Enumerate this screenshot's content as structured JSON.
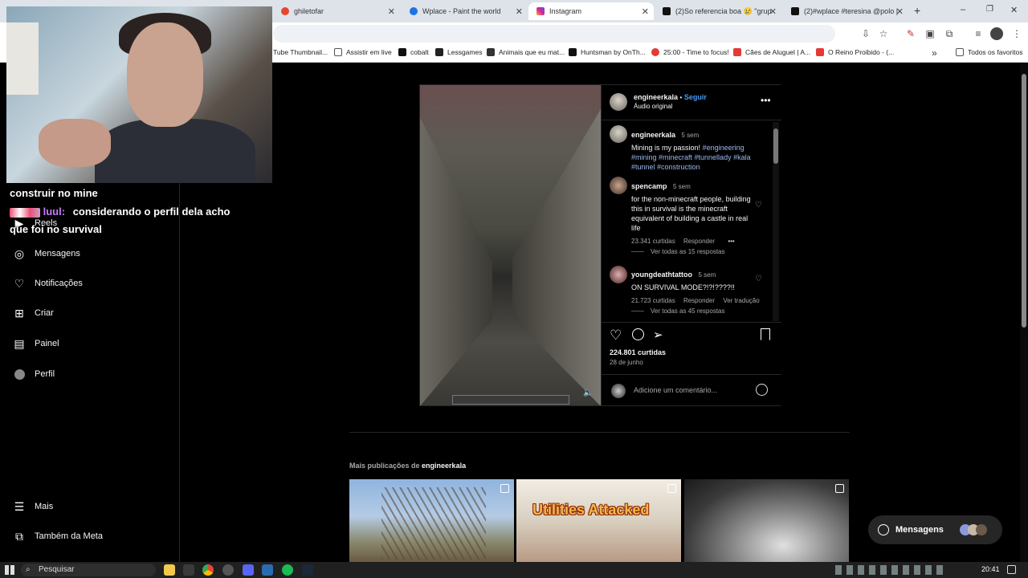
{
  "browser": {
    "tabs": [
      {
        "label": "ghiletofar",
        "favicon_color": "#e8452c"
      },
      {
        "label": "Wplace - Paint the world",
        "favicon_color": "#1a73e8"
      },
      {
        "label": "Instagram",
        "favicon_color": "#d6249f"
      },
      {
        "label": "(2)So referencia boa 😢 \"grupo",
        "favicon_color": "#111111"
      },
      {
        "label": "(2)#wplace #teresina @polo | w",
        "favicon_color": "#111111"
      }
    ],
    "new_tab": "+",
    "window_controls": [
      "–",
      "❐",
      "✕"
    ],
    "bookmarks": [
      {
        "label": "Tube Thumbnail..."
      },
      {
        "label": "Assistir em live"
      },
      {
        "label": "cobalt"
      },
      {
        "label": "Lessgames"
      },
      {
        "label": "Animais que eu mat..."
      },
      {
        "label": "Huntsman by OnTh..."
      },
      {
        "label": "25:00 - Time to focus!"
      },
      {
        "label": "Cães de Aluguel | A..."
      },
      {
        "label": "O Reino Proibido - (..."
      },
      {
        "label": "Todos os favoritos"
      }
    ],
    "bookmarks_more": "»"
  },
  "chat": {
    "line1": "construir no mine",
    "line2_user": "luul:",
    "line2_text": "considerando o perfil dela acho",
    "line3": "que foi no survival"
  },
  "sidebar": {
    "items": [
      {
        "label": "Reels",
        "icon": "reels-icon"
      },
      {
        "label": "Mensagens",
        "icon": "messenger-icon"
      },
      {
        "label": "Notificações",
        "icon": "heart-icon"
      },
      {
        "label": "Criar",
        "icon": "plus-square-icon"
      },
      {
        "label": "Painel",
        "icon": "chart-icon"
      },
      {
        "label": "Perfil",
        "icon": "avatar-icon"
      }
    ],
    "bottom": [
      {
        "label": "Mais",
        "icon": "menu-icon"
      },
      {
        "label": "Também da Meta",
        "icon": "meta-icon"
      }
    ]
  },
  "post": {
    "username": "engineerkala",
    "follow": "Seguir",
    "audio": "Áudio original",
    "caption": {
      "username": "engineerkala",
      "time": "5 sem",
      "text": "Mining is my passion!",
      "tags": "#engineering #mining #minecraft #tunnellady #kala #tunnel #construction"
    },
    "comments": [
      {
        "username": "spencamp",
        "time": "5 sem",
        "text": "for the non-minecraft people, building this in survival is the minecraft equivalent of building a castle in real life",
        "likes": "23.341 curtidas",
        "reply": "Responder",
        "more": "•••",
        "view_replies": "Ver todas as 15 respostas"
      },
      {
        "username": "youngdeathtattoo",
        "time": "5 sem",
        "text": "ON SURVIVAL MODE?!?!????!!",
        "likes": "21.723 curtidas",
        "reply": "Responder",
        "translate": "Ver tradução",
        "view_replies": "Ver todas as 45 respostas"
      }
    ],
    "likes": "224.801 curtidas",
    "date": "28 de junho",
    "comment_placeholder": "Adicione um comentário..."
  },
  "more_posts": {
    "prefix": "Mais publicações de",
    "username": "engineerkala",
    "thumb2_text": "Utilities Attacked"
  },
  "messages_pill": {
    "label": "Mensagens"
  },
  "taskbar": {
    "search": "Pesquisar",
    "clock": "20:41"
  }
}
